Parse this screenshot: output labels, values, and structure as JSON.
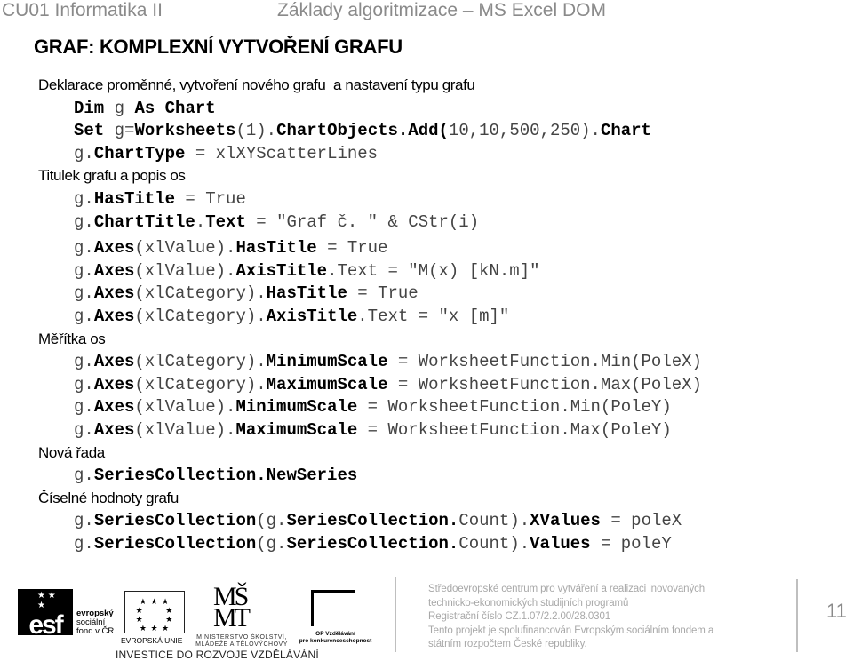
{
  "header": {
    "course": "CU01 Informatika II",
    "topic": "Základy algoritmizace – MS Excel DOM"
  },
  "slide": {
    "title": "GRAF: KOMPLEXNÍ VYTVOŘENÍ GRAFU",
    "lines": [
      {
        "type": "text",
        "text": "Deklarace proměnné, vytvoření nového grafu  a nastavení typu grafu"
      },
      {
        "type": "code",
        "parts": [
          [
            "k",
            "Dim"
          ],
          [
            "n",
            " g "
          ],
          [
            "k",
            "As Chart"
          ]
        ]
      },
      {
        "type": "code",
        "parts": [
          [
            "k",
            "Set"
          ],
          [
            "n",
            " g="
          ],
          [
            "k",
            "Worksheets"
          ],
          [
            "n",
            "(1)."
          ],
          [
            "k",
            "ChartObjects.Add("
          ],
          [
            "n",
            "10,10,500,250)."
          ],
          [
            "k",
            "Chart"
          ]
        ]
      },
      {
        "type": "code",
        "parts": [
          [
            "n",
            "g."
          ],
          [
            "k",
            "ChartType"
          ],
          [
            "n",
            " = xlXYScatterLines"
          ]
        ]
      },
      {
        "type": "text",
        "text": "Titulek grafu a popis os"
      },
      {
        "type": "code",
        "parts": [
          [
            "n",
            "g."
          ],
          [
            "k",
            "HasTitle"
          ],
          [
            "n",
            " = True"
          ]
        ]
      },
      {
        "type": "code",
        "parts": [
          [
            "n",
            "g."
          ],
          [
            "k",
            "ChartTitle"
          ],
          [
            "n",
            "."
          ],
          [
            "k",
            "Text"
          ],
          [
            "n",
            " = \"Graf č. \" & CStr(i)"
          ]
        ]
      },
      {
        "type": "gap"
      },
      {
        "type": "code",
        "parts": [
          [
            "n",
            "g."
          ],
          [
            "k",
            "Axes"
          ],
          [
            "n",
            "(xlValue)."
          ],
          [
            "k",
            "HasTitle"
          ],
          [
            "n",
            " = True"
          ]
        ]
      },
      {
        "type": "code",
        "parts": [
          [
            "n",
            "g."
          ],
          [
            "k",
            "Axes"
          ],
          [
            "n",
            "(xlValue)."
          ],
          [
            "k",
            "AxisTitle"
          ],
          [
            "n",
            ".Text = \"M(x) [kN.m]\""
          ]
        ]
      },
      {
        "type": "code",
        "parts": [
          [
            "n",
            "g."
          ],
          [
            "k",
            "Axes"
          ],
          [
            "n",
            "(xlCategory)."
          ],
          [
            "k",
            "HasTitle"
          ],
          [
            "n",
            " = True"
          ]
        ]
      },
      {
        "type": "code",
        "parts": [
          [
            "n",
            "g."
          ],
          [
            "k",
            "Axes"
          ],
          [
            "n",
            "(xlCategory)."
          ],
          [
            "k",
            "AxisTitle"
          ],
          [
            "n",
            ".Text = \"x [m]\""
          ]
        ]
      },
      {
        "type": "text",
        "text": "Měřítka os"
      },
      {
        "type": "code",
        "parts": [
          [
            "n",
            "g."
          ],
          [
            "k",
            "Axes"
          ],
          [
            "n",
            "(xlCategory)."
          ],
          [
            "k",
            "MinimumScale"
          ],
          [
            "n",
            " = WorksheetFunction.Min(PoleX)"
          ]
        ]
      },
      {
        "type": "code",
        "parts": [
          [
            "n",
            "g."
          ],
          [
            "k",
            "Axes"
          ],
          [
            "n",
            "(xlCategory)."
          ],
          [
            "k",
            "MaximumScale"
          ],
          [
            "n",
            " = WorksheetFunction.Max(PoleX)"
          ]
        ]
      },
      {
        "type": "code",
        "parts": [
          [
            "n",
            "g."
          ],
          [
            "k",
            "Axes"
          ],
          [
            "n",
            "(xlValue)."
          ],
          [
            "k",
            "MinimumScale"
          ],
          [
            "n",
            " = WorksheetFunction.Min(PoleY)"
          ]
        ]
      },
      {
        "type": "code",
        "parts": [
          [
            "n",
            "g."
          ],
          [
            "k",
            "Axes"
          ],
          [
            "n",
            "(xlValue)."
          ],
          [
            "k",
            "MaximumScale"
          ],
          [
            "n",
            " = WorksheetFunction.Max(PoleY)"
          ]
        ]
      },
      {
        "type": "text",
        "text": "Nová řada"
      },
      {
        "type": "code",
        "parts": [
          [
            "n",
            "g."
          ],
          [
            "k",
            "SeriesCollection.NewSeries"
          ]
        ]
      },
      {
        "type": "text",
        "text": "Číselné hodnoty grafu"
      },
      {
        "type": "code",
        "parts": [
          [
            "n",
            "g."
          ],
          [
            "k",
            "SeriesCollection"
          ],
          [
            "n",
            "(g."
          ],
          [
            "k",
            "SeriesCollection."
          ],
          [
            "n",
            "Count)."
          ],
          [
            "k",
            "XValues"
          ],
          [
            "n",
            " = poleX"
          ]
        ]
      },
      {
        "type": "code",
        "parts": [
          [
            "n",
            "g."
          ],
          [
            "k",
            "SeriesCollection"
          ],
          [
            "n",
            "(g."
          ],
          [
            "k",
            "SeriesCollection."
          ],
          [
            "n",
            "Count)."
          ],
          [
            "k",
            "Values"
          ],
          [
            "n",
            " = poleY"
          ]
        ]
      }
    ]
  },
  "footer": {
    "logos": {
      "esf_mark": "esf",
      "esf_label": [
        "evropský",
        "sociální",
        "fond v ČR"
      ],
      "eu_label": "EVROPSKÁ UNIE",
      "eu_stars": "★ ★ ★",
      "msmt_mark": "MŠ MT",
      "msmt_label": [
        "MINISTERSTVO ŠKOLSTVÍ,",
        "MLÁDEŽE A TĚLOVÝCHOVY"
      ],
      "op_label": [
        "OP Vzdělávání",
        "pro konkurenceschopnost"
      ],
      "investice": "INVESTICE DO ROZVOJE VZDĚLÁVÁNÍ"
    },
    "project_lines": [
      "Středoevropské centrum pro vytváření a realizaci inovovaných",
      "technicko-ekonomických studijních programů",
      "Registrační číslo CZ.1.07/2.2.00/28.0301",
      "Tento projekt je spolufinancován Evropským sociálním fondem a",
      "státním rozpočtem České republiky."
    ],
    "page_number": "11"
  }
}
